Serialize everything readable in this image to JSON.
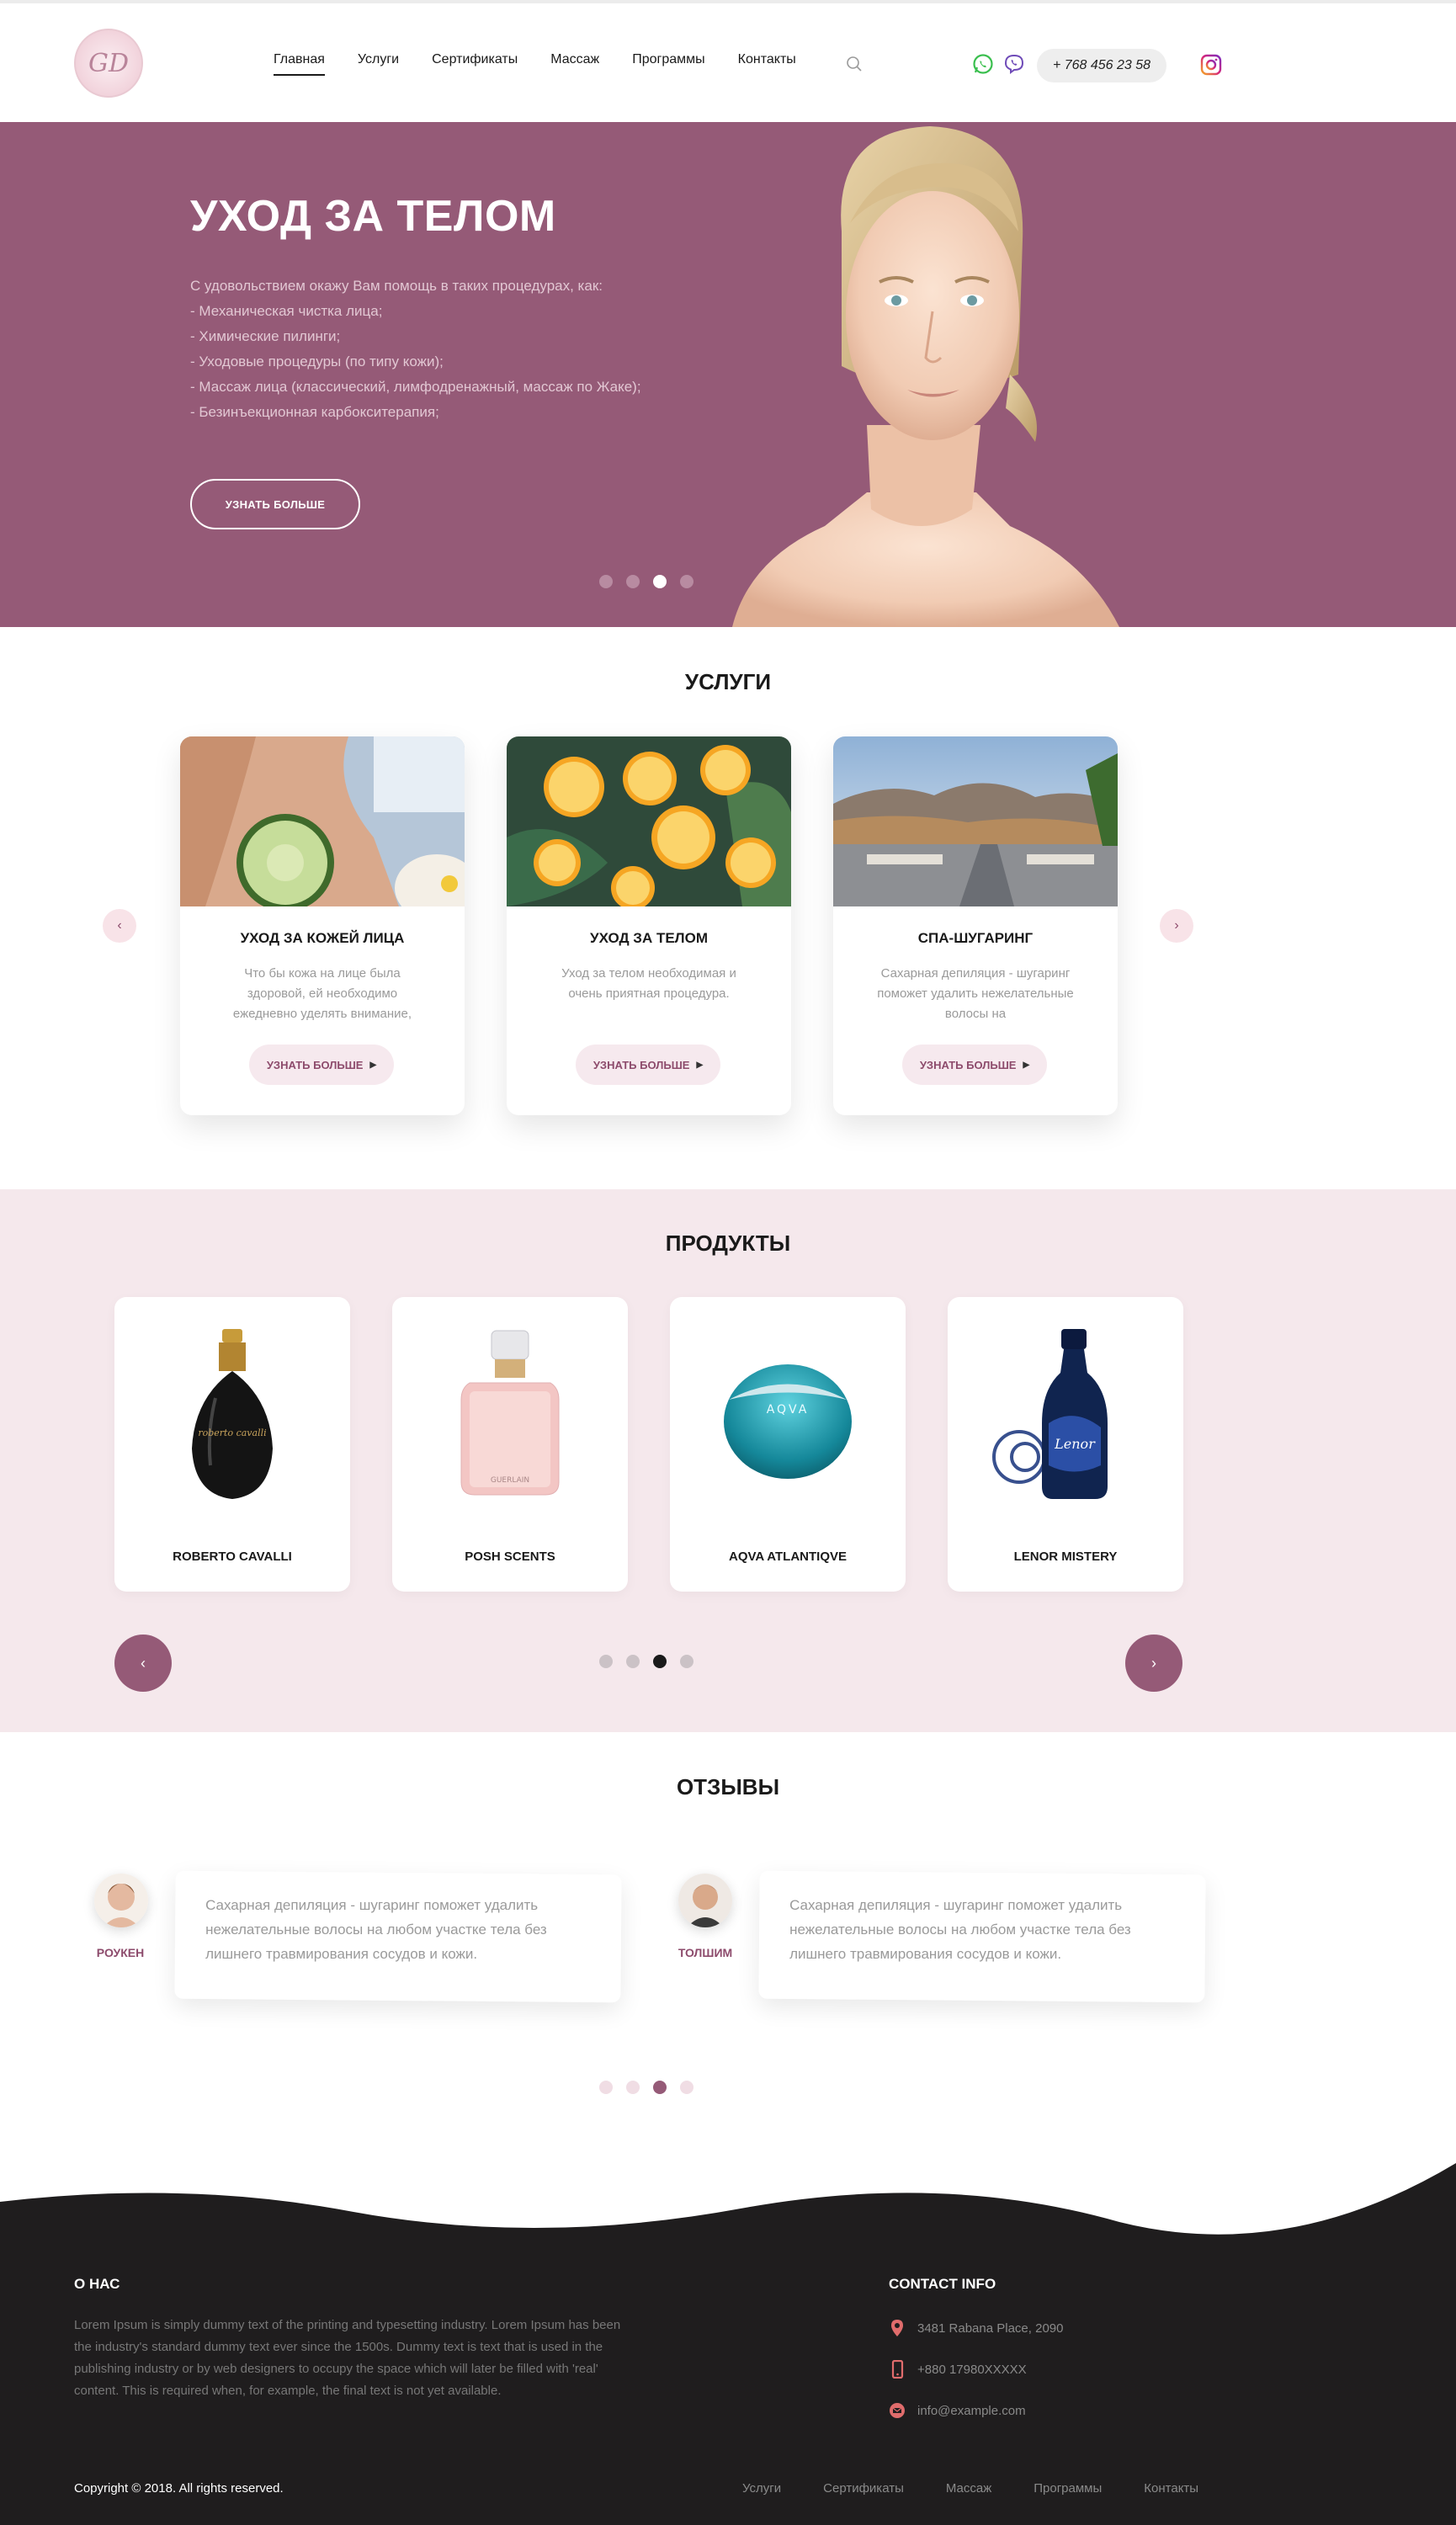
{
  "header": {
    "logo_text": "GD",
    "nav": [
      "Главная",
      "Услуги",
      "Сертификаты",
      "Массаж",
      "Программы",
      "Контакты"
    ],
    "phone": "+ 768 456 23 58",
    "icons": [
      "search-icon",
      "whatsapp-icon",
      "viber-icon",
      "instagram-icon"
    ]
  },
  "hero": {
    "title": "УХОД ЗА ТЕЛОМ",
    "intro": "С удовольствием окажу Вам помощь в таких процедурах, как:",
    "items": [
      "- Механическая чистка лица;",
      "- Химические пилинги;",
      "- Уходовые процедуры (по типу кожи);",
      "- Массаж лица (классический, лимфодренажный, массаж по Жаке);",
      "- Безинъекционная карбокситерапия;"
    ],
    "button": "УЗНАТЬ БОЛЬШЕ",
    "slides": 4,
    "active_slide": 3
  },
  "services": {
    "title": "УСЛУГИ",
    "prev": "‹",
    "next": "›",
    "cards": [
      {
        "title": "УХОД ЗА КОЖЕЙ ЛИЦА",
        "text": "Что бы кожа на лице была здоровой, ей необходимо ежедневно уделять внимание,",
        "button": "УЗНАТЬ БОЛЬШЕ"
      },
      {
        "title": "УХОД ЗА ТЕЛОМ",
        "text": "Уход за телом необходимая и очень приятная процедура.",
        "button": "УЗНАТЬ БОЛЬШЕ"
      },
      {
        "title": "СПА-ШУГАРИНГ",
        "text": "Сахарная депиляция - шугаринг поможет удалить нежелательные волосы на",
        "button": "УЗНАТЬ БОЛЬШЕ"
      }
    ]
  },
  "products": {
    "title": "ПРОДУКТЫ",
    "prev": "‹",
    "next": "›",
    "items": [
      "ROBERTO CAVALLI",
      "POSH SCENTS",
      "AQVA ATLANTIQVE",
      "LENOR MISTERY"
    ],
    "slides": 4,
    "active_slide": 3
  },
  "reviews": {
    "title": "ОТЗЫВЫ",
    "items": [
      {
        "name": "РОУКЕН",
        "text": "Сахарная депиляция - шугаринг поможет удалить нежелательные волосы на любом участке тела без лишнего травмирования сосудов и кожи."
      },
      {
        "name": "ТОЛШИМ",
        "text": "Сахарная депиляция - шугаринг поможет удалить нежелательные волосы на любом участке тела без лишнего травмирования сосудов и кожи."
      }
    ],
    "slides": 4,
    "active_slide": 3
  },
  "footer": {
    "about_title": "О НАС",
    "about_text": "Lorem Ipsum is simply dummy text of the printing and typesetting industry. Lorem Ipsum has been the industry's standard dummy text ever since the 1500s. Dummy text is text that is used in the publishing industry or by web designers to occupy the space which will later be filled with 'real' content. This is required when, for example, the final text is not yet available.",
    "contact_title": "CONTACT INFO",
    "address": "3481 Rabana Place, 2090",
    "phone": "+880 17980XXXXX",
    "email": "info@example.com",
    "copyright": "Copyright © 2018. All rights reserved.",
    "nav": [
      "Услуги",
      "Сертификаты",
      "Массаж",
      "Программы",
      "Контакты"
    ]
  },
  "colors": {
    "brand": "#955a77",
    "accent": "#8d4b6c",
    "footer_bg": "#1f1d1e",
    "products_bg": "#f5e8ec"
  }
}
